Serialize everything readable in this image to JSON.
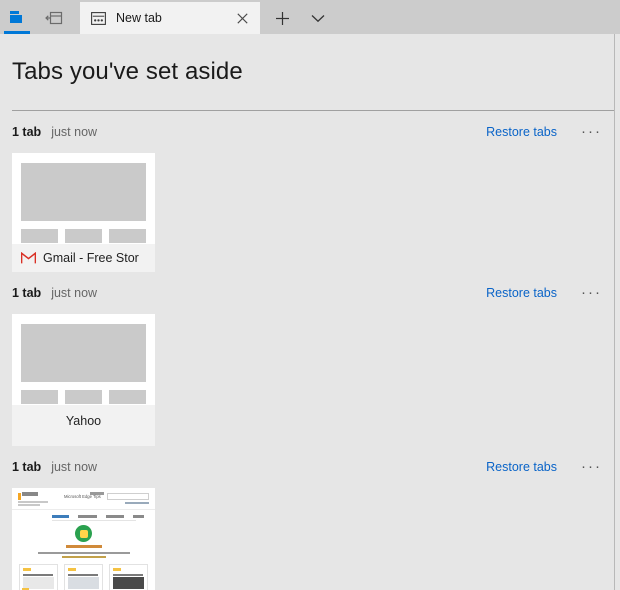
{
  "window": {
    "titlebar": {
      "set_aside_button": "Tabs you've set aside",
      "set_aside_icon": "tabs-set-aside-icon",
      "restore_button": "Restore tabs you've set aside",
      "restore_icon": "restore-tabs-icon",
      "new_tab_button": "New tab",
      "new_tab_icon": "plus-icon",
      "tab_list_button": "Tab options",
      "tab_list_icon": "chevron-down-icon",
      "accent_color": "#0078d7",
      "bar_color": "#cccccc"
    },
    "tabs": [
      {
        "title": "New tab",
        "favicon": "new-tab-icon",
        "close_label": "Close tab",
        "close_icon": "close-icon",
        "active": true
      }
    ]
  },
  "page": {
    "title": "Tabs you've set aside",
    "background": "#e6e6e6",
    "link_color": "#0a64c8",
    "groups": [
      {
        "count_label": "1 tab",
        "time_label": "just now",
        "restore_label": "Restore tabs",
        "more_label": "···",
        "more_icon": "more-options-icon",
        "card": {
          "title": "Gmail - Free Stor",
          "favicon": "gmail-icon",
          "favicon_color": "#d93025",
          "thumbnail": "placeholder",
          "align": "left"
        }
      },
      {
        "count_label": "1 tab",
        "time_label": "just now",
        "restore_label": "Restore tabs",
        "more_label": "···",
        "more_icon": "more-options-icon",
        "card": {
          "title": "Yahoo",
          "favicon": "",
          "favicon_color": "",
          "thumbnail": "placeholder",
          "align": "center"
        }
      },
      {
        "count_label": "1 tab",
        "time_label": "just now",
        "restore_label": "Restore tabs",
        "more_label": "···",
        "more_icon": "more-options-icon",
        "card": {
          "title": "",
          "favicon": "",
          "favicon_color": "",
          "thumbnail": "microsoft-edge-tips-page",
          "thumbnail_heading": "Microsoft Edge Tips",
          "align": "left"
        }
      }
    ]
  }
}
